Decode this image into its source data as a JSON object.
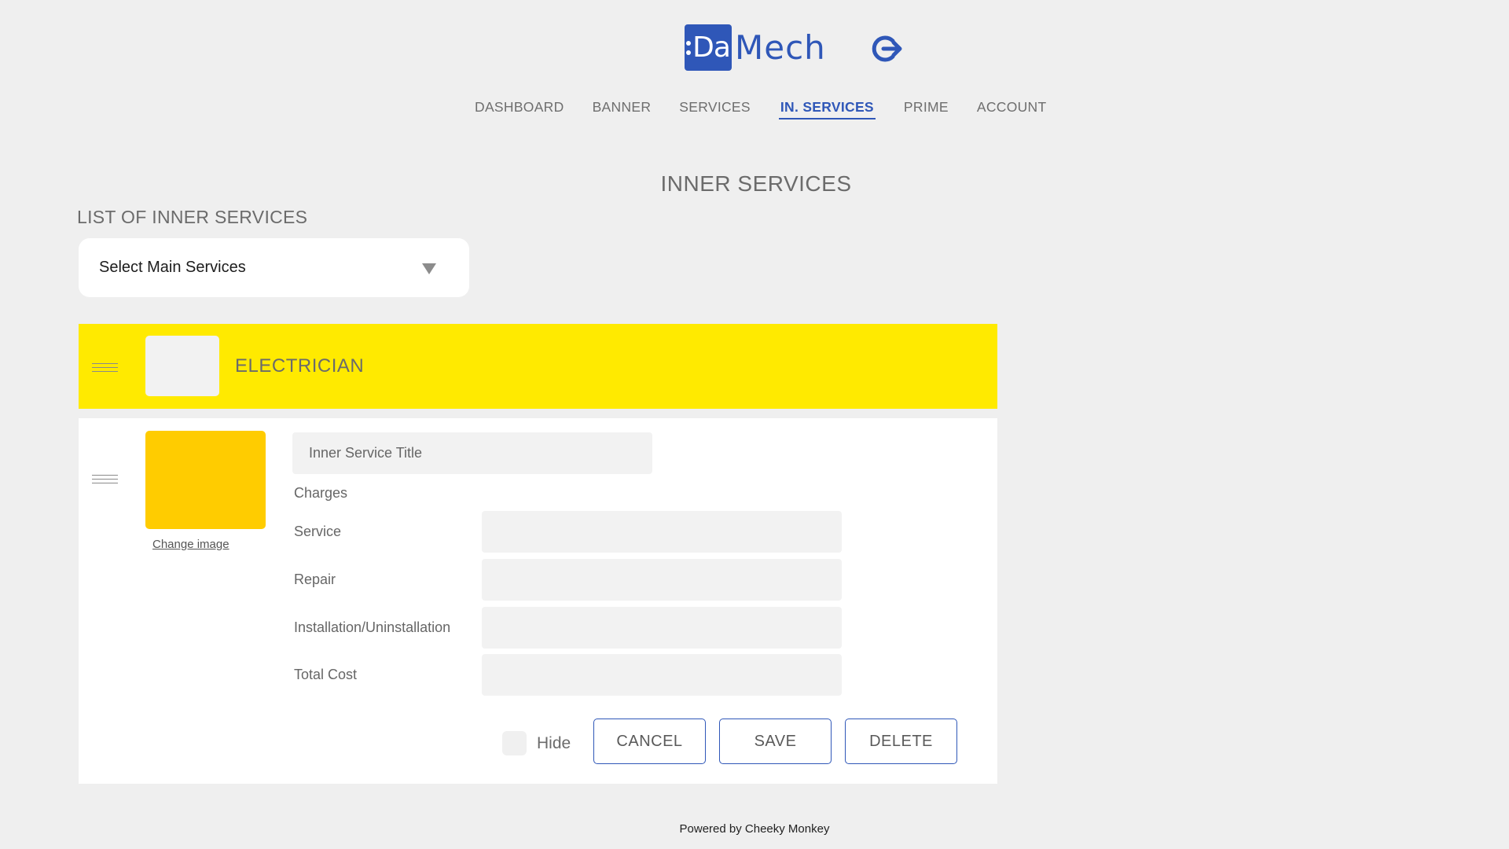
{
  "brand": {
    "logo_mark": "Da",
    "logo_text": "Mech",
    "logout_icon": "logout-icon",
    "accent_color": "#2f57b8"
  },
  "nav": {
    "items": [
      {
        "label": "DASHBOARD",
        "active": false
      },
      {
        "label": "BANNER",
        "active": false
      },
      {
        "label": "SERVICES",
        "active": false
      },
      {
        "label": "IN. SERVICES",
        "active": true
      },
      {
        "label": "PRIME",
        "active": false
      },
      {
        "label": "ACCOUNT",
        "active": false
      }
    ]
  },
  "page": {
    "title": "INNER SERVICES",
    "list_title": "LIST OF INNER SERVICES"
  },
  "select_main": {
    "value": "Select Main Services",
    "icon": "dropdown-arrow-icon"
  },
  "category": {
    "name": "ELECTRICIAN",
    "color": "#ffea00"
  },
  "editor": {
    "image_color": "#ffcc00",
    "change_image_label": "Change image",
    "title_placeholder": "Inner Service Title",
    "charges_label": "Charges",
    "charges": [
      {
        "label": "Service",
        "value": ""
      },
      {
        "label": "Repair",
        "value": ""
      },
      {
        "label": "Installation/Uninstallation",
        "value": ""
      },
      {
        "label": "Total Cost",
        "value": ""
      }
    ],
    "hide_label": "Hide",
    "hide_checked": false,
    "cancel_label": "CANCEL",
    "save_label": "SAVE",
    "delete_label": "DELETE"
  },
  "footer": {
    "text": "Powered by Cheeky Monkey"
  }
}
